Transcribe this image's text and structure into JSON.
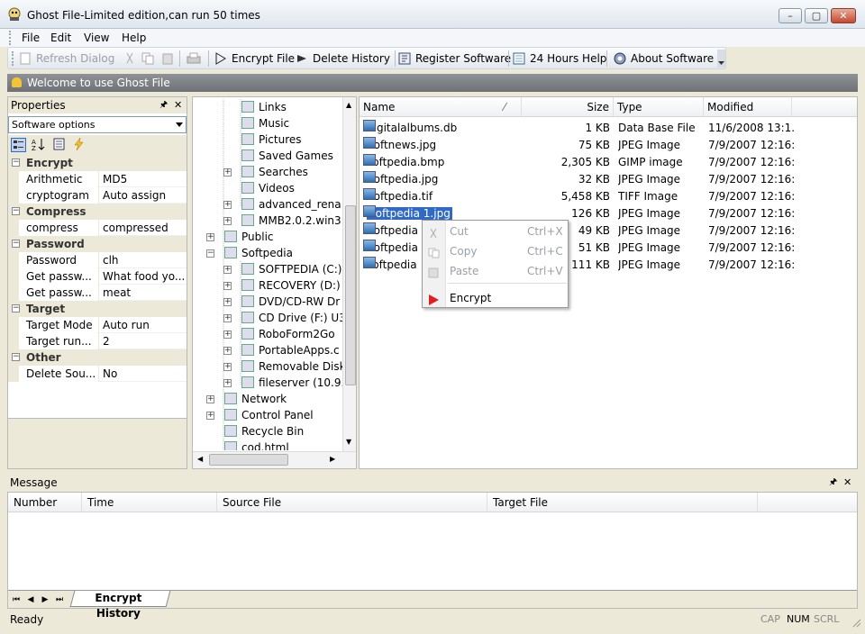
{
  "window": {
    "title": "Ghost File-Limited edition,can run 50 times",
    "min": "–",
    "max": "▢",
    "close": "✕"
  },
  "menu": [
    "File",
    "Edit",
    "View",
    "Help"
  ],
  "toolbar": {
    "refresh": "Refresh Dialog",
    "encrypt": "Encrypt File",
    "delete_history": "Delete History",
    "register": "Register Software",
    "help24": "24 Hours Help",
    "about": "About Software"
  },
  "banner": "Welcome to use Ghost File",
  "properties": {
    "title": "Properties",
    "pin": "🖈",
    "close": "✕",
    "select_value": "Software options",
    "categories": [
      {
        "name": "Encrypt",
        "rows": [
          {
            "k": "Arithmetic",
            "v": "MD5"
          },
          {
            "k": "cryptogram",
            "v": "Auto assign"
          }
        ]
      },
      {
        "name": "Compress",
        "rows": [
          {
            "k": "compress",
            "v": "compressed"
          }
        ]
      },
      {
        "name": "Password",
        "rows": [
          {
            "k": "Password",
            "v": "clh"
          },
          {
            "k": "Get passw...",
            "v": "What food yo..."
          },
          {
            "k": "Get passw...",
            "v": "meat"
          }
        ]
      },
      {
        "name": "Target",
        "rows": [
          {
            "k": "Target Mode",
            "v": "Auto run"
          },
          {
            "k": "Target run...",
            "v": "2"
          }
        ]
      },
      {
        "name": "Other",
        "rows": [
          {
            "k": "Delete Sou...",
            "v": "No"
          }
        ]
      }
    ]
  },
  "tree": [
    {
      "label": "Links",
      "indent": 2
    },
    {
      "label": "Music",
      "indent": 2
    },
    {
      "label": "Pictures",
      "indent": 2
    },
    {
      "label": "Saved Games",
      "indent": 2
    },
    {
      "label": "Searches",
      "indent": 2,
      "exp": true
    },
    {
      "label": "Videos",
      "indent": 2
    },
    {
      "label": "advanced_rena",
      "indent": 2,
      "exp": true
    },
    {
      "label": "MMB2.0.2.win3",
      "indent": 2,
      "exp": true
    },
    {
      "label": "Public",
      "indent": 1,
      "exp": true
    },
    {
      "label": "Softpedia",
      "indent": 1,
      "exp": true,
      "open": true
    },
    {
      "label": "SOFTPEDIA (C:)",
      "indent": 2,
      "exp": true
    },
    {
      "label": "RECOVERY (D:)",
      "indent": 2,
      "exp": true
    },
    {
      "label": "DVD/CD-RW Dr",
      "indent": 2,
      "exp": true
    },
    {
      "label": "CD Drive (F:) U3",
      "indent": 2,
      "exp": true
    },
    {
      "label": "RoboForm2Go",
      "indent": 2,
      "exp": true
    },
    {
      "label": "PortableApps.c",
      "indent": 2,
      "exp": true
    },
    {
      "label": "Removable Disk",
      "indent": 2,
      "exp": true
    },
    {
      "label": "fileserver (10.9.0",
      "indent": 2,
      "exp": true
    },
    {
      "label": "Network",
      "indent": 1,
      "exp": true
    },
    {
      "label": "Control Panel",
      "indent": 1,
      "exp": true
    },
    {
      "label": "Recycle Bin",
      "indent": 1
    },
    {
      "label": "cod.html",
      "indent": 1
    }
  ],
  "files": {
    "columns": [
      "Name",
      "Size",
      "Type",
      "Modified"
    ],
    "sort_glyph": "⁄",
    "rows": [
      {
        "name": "digitalalbums.db",
        "size": "1 KB",
        "type": "Data Base File",
        "modified": "11/6/2008 13:1..."
      },
      {
        "name": "Softnews.jpg",
        "size": "75 KB",
        "type": "JPEG Image",
        "modified": "7/9/2007 12:16:..."
      },
      {
        "name": "softpedia.bmp",
        "size": "2,305 KB",
        "type": "GIMP image",
        "modified": "7/9/2007 12:16:..."
      },
      {
        "name": "Softpedia.jpg",
        "size": "32 KB",
        "type": "JPEG Image",
        "modified": "7/9/2007 12:16:..."
      },
      {
        "name": "Softpedia.tif",
        "size": "5,458 KB",
        "type": "TIFF Image",
        "modified": "7/9/2007 12:16:..."
      },
      {
        "name": "Softpedia 1.jpg",
        "size": "126 KB",
        "type": "JPEG Image",
        "modified": "7/9/2007 12:16:...",
        "selected": true
      },
      {
        "name": "Softpedia",
        "size": "49 KB",
        "type": "JPEG Image",
        "modified": "7/9/2007 12:16:..."
      },
      {
        "name": "Softpedia",
        "size": "51 KB",
        "type": "JPEG Image",
        "modified": "7/9/2007 12:16:..."
      },
      {
        "name": "softpedia",
        "size": "111 KB",
        "type": "JPEG Image",
        "modified": "7/9/2007 12:16:..."
      }
    ]
  },
  "context_menu": [
    {
      "label": "Cut",
      "shortcut": "Ctrl+X",
      "disabled": true
    },
    {
      "label": "Copy",
      "shortcut": "Ctrl+C",
      "disabled": true
    },
    {
      "label": "Paste",
      "shortcut": "Ctrl+V",
      "disabled": true
    },
    {
      "label": "Encrypt",
      "shortcut": "",
      "disabled": false
    }
  ],
  "message": {
    "title": "Message",
    "pin": "🖈",
    "close": "✕",
    "columns": [
      "Number",
      "Time",
      "Source File",
      "Target File"
    ],
    "nav": [
      "⏮",
      "◀",
      "▶",
      "⏭"
    ],
    "tab": "Encrypt History"
  },
  "status": {
    "text": "Ready",
    "indicators": [
      "CAP",
      "NUM",
      "SCRL"
    ]
  },
  "colors": {
    "selection": "#316ac5",
    "banner": "#7a7d81",
    "encrypt_arrow": "#e02020"
  }
}
